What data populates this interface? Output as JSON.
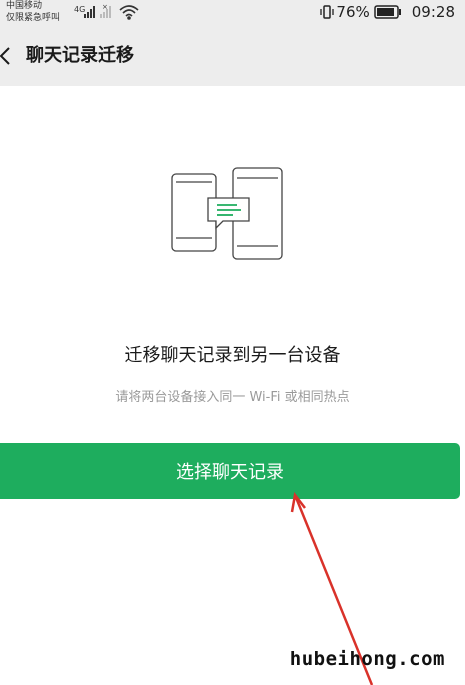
{
  "status_bar": {
    "carrier_line1": "中国移动",
    "carrier_line2": "仅限紧急呼叫",
    "network_type": "4G",
    "battery_percent": "76%",
    "time": "09:28"
  },
  "header": {
    "title": "聊天记录迁移",
    "back_icon": "chevron-left-icon"
  },
  "main": {
    "illustration_icon": "two-phones-transfer-icon",
    "title": "迁移聊天记录到另一台设备",
    "subtitle": "请将两台设备接入同一 Wi-Fi 或相同热点"
  },
  "button": {
    "label": "选择聊天记录",
    "color": "#1ead5e"
  },
  "watermark": "hubeihong.com"
}
